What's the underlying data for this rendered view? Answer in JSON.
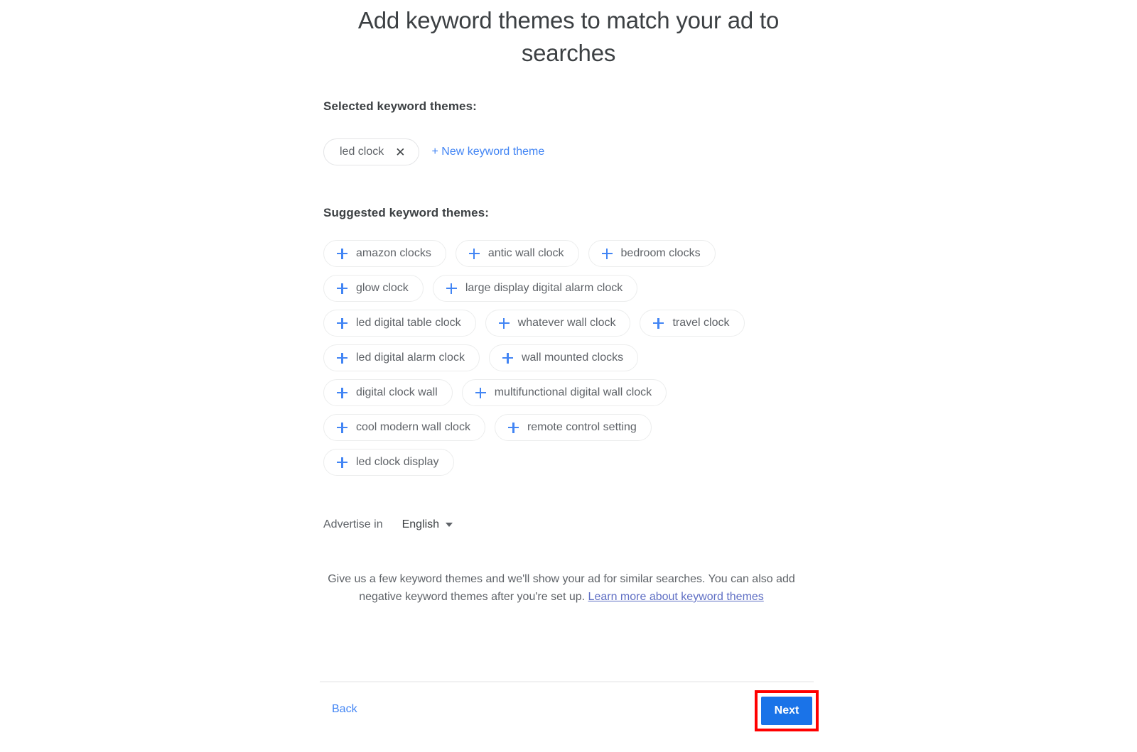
{
  "page": {
    "title": "Add keyword themes to match your ad to searches"
  },
  "selected": {
    "label": "Selected keyword themes:",
    "chips": [
      {
        "text": "led clock",
        "remove_icon": "close-icon"
      }
    ],
    "new_theme_link": "+ New keyword theme"
  },
  "suggested": {
    "label": "Suggested keyword themes:",
    "rows": [
      [
        "amazon clocks",
        "antic wall clock",
        "bedroom clocks"
      ],
      [
        "glow clock",
        "large display digital alarm clock"
      ],
      [
        "led digital table clock",
        "whatever wall clock",
        "travel clock"
      ],
      [
        "led digital alarm clock",
        "wall mounted clocks"
      ],
      [
        "digital clock wall",
        "multifunctional digital wall clock"
      ],
      [
        "cool modern wall clock",
        "remote control setting"
      ],
      [
        "led clock display"
      ]
    ]
  },
  "advertise": {
    "label": "Advertise in",
    "selected_language": "English",
    "caret_icon": "chevron-down-icon"
  },
  "helper": {
    "text_before": "Give us a few keyword themes and we'll show your ad for similar searches. You can also add negative keyword themes after you're set up. ",
    "link_text": "Learn more about keyword themes"
  },
  "footer": {
    "back_label": "Back",
    "next_label": "Next"
  },
  "colors": {
    "accent_blue": "#4285f4",
    "button_blue": "#1a73e8",
    "highlight_red": "#ff0000",
    "text_primary": "#3c4043",
    "text_secondary": "#5f6368",
    "link_purple": "#5f6fc4",
    "chip_border": "#eceded"
  }
}
